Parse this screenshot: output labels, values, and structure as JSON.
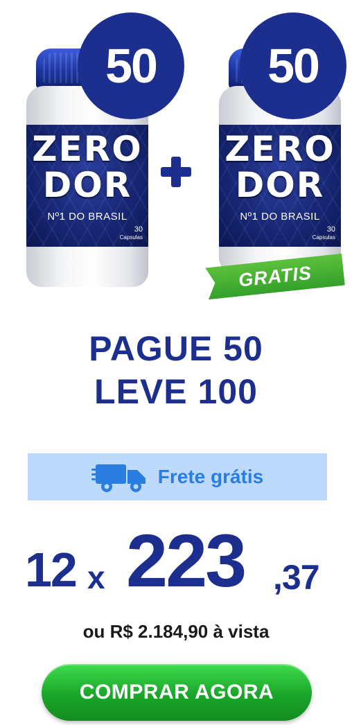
{
  "offer": {
    "bottle_left": {
      "badge": "50",
      "brand_line1": "ZERO",
      "brand_line2": "DOR",
      "tagline": "Nº1 DO BRASIL",
      "count": "30",
      "count_unit": "Capsulas"
    },
    "bottle_right": {
      "badge": "50",
      "brand_line1": "ZERO",
      "brand_line2": "DOR",
      "tagline": "Nº1 DO BRASIL",
      "count": "30",
      "count_unit": "Capsulas",
      "ribbon": "GRATIS"
    },
    "headline_line1": "PAGUE 50",
    "headline_line2": "LEVE 100"
  },
  "shipping": {
    "label": "Frete grátis",
    "icon": "delivery-truck-icon"
  },
  "price": {
    "installments": "12",
    "multiplier": "x",
    "amount_integer": "223",
    "amount_cents": ",37",
    "cash_text": "ou R$ 2.184,90 à vista"
  },
  "cta": {
    "label": "COMPRAR AGORA"
  },
  "colors": {
    "brand_blue": "#1c2f8f",
    "shipping_bg": "#bdd9fb",
    "shipping_text": "#2a7ee0",
    "cta_green": "#1aa52a",
    "ribbon_green": "#34a02a"
  }
}
